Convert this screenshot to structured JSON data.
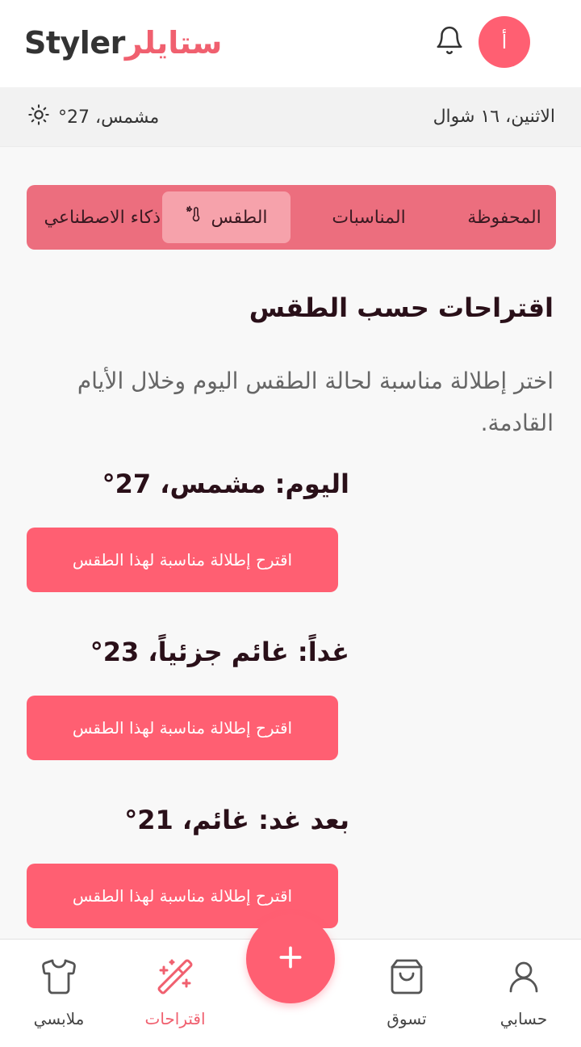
{
  "header": {
    "logo_ar": "ستايلر",
    "logo_en": "Styler",
    "avatar_initial": "أ"
  },
  "infobar": {
    "date": "الاثنين، ١٦ شوال",
    "weather": "مشمس، 27°"
  },
  "tabs": [
    {
      "label": "المحفوظة",
      "active": false
    },
    {
      "label": "المناسبات",
      "active": false
    },
    {
      "label": "الطقس",
      "active": true,
      "icon": "thermometer-sun-icon"
    },
    {
      "label": "ذكاء الاصطناعي",
      "active": false
    }
  ],
  "section": {
    "title": "اقتراحات حسب الطقس",
    "description": "اختر إطلالة مناسبة لحالة الطقس اليوم وخلال الأيام القادمة."
  },
  "days": [
    {
      "title": "اليوم: مشمس، 27°",
      "button": "اقترح إطلالة مناسبة لهذا الطقس"
    },
    {
      "title": "غداً: غائم جزئياً، 23°",
      "button": "اقترح إطلالة مناسبة لهذا الطقس"
    },
    {
      "title": "بعد غد: غائم، 21°",
      "button": "اقترح إطلالة مناسبة لهذا الطقس"
    }
  ],
  "bottom_nav": [
    {
      "label": "ملابسي",
      "icon": "shirt-icon",
      "active": false
    },
    {
      "label": "اقتراحات",
      "icon": "magic-wand-icon",
      "active": true
    },
    {
      "label": "تسوق",
      "icon": "shopping-bag-icon",
      "active": false
    },
    {
      "label": "حسابي",
      "icon": "user-icon",
      "active": false
    }
  ],
  "fab": {
    "icon": "plus-icon"
  },
  "colors": {
    "accent": "#ff5f72",
    "tab_bar": "#ec6e7e",
    "tab_active": "#f6a2ab"
  }
}
